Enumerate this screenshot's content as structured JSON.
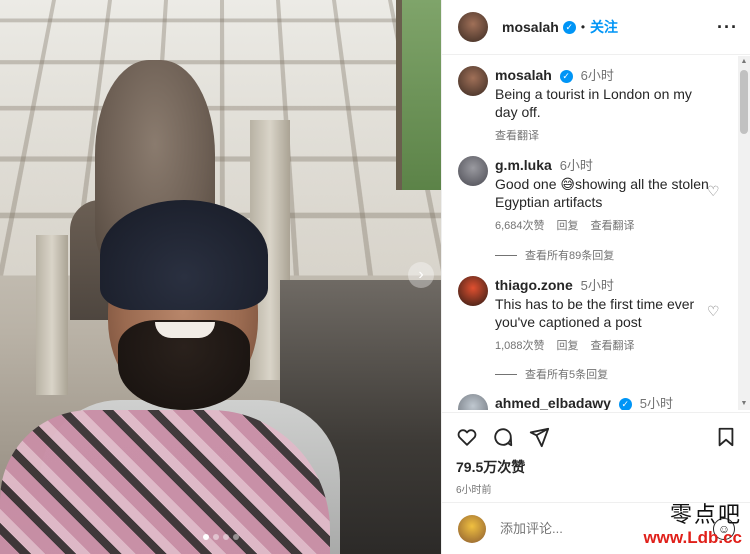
{
  "post": {
    "username": "mosalah",
    "separator": "•",
    "follow_label": "关注",
    "more_label": "···",
    "carousel_next_label": "›"
  },
  "caption": {
    "username": "mosalah",
    "time": "6小时",
    "text": "Being a tourist in London on my day off.",
    "translate": "查看翻译"
  },
  "comments": [
    {
      "username": "g.m.luka",
      "time": "6小时",
      "text": "Good one 😅showing all the stolen Egyptian artifacts",
      "likes": "6,684次赞",
      "reply": "回复",
      "translate": "查看翻译",
      "view_replies": "查看所有89条回复"
    },
    {
      "username": "thiago.zone",
      "time": "5小时",
      "text": "This has to be the first time ever you've captioned a post",
      "likes": "1,088次赞",
      "reply": "回复",
      "translate": "查看翻译",
      "view_replies": "查看所有5条回复"
    },
    {
      "username": "ahmed_elbadawy",
      "time": "5小时",
      "verified": true
    }
  ],
  "actions": {
    "like_count": "79.5万次赞",
    "posted_time": "6小时前"
  },
  "add_comment": {
    "placeholder": "添加评论..."
  },
  "watermark": {
    "chinese": "零点吧",
    "url": "www.Ldb.cc"
  },
  "colors": {
    "accent": "#0095f6",
    "muted": "#737373",
    "watermark_red": "#e0201a"
  }
}
